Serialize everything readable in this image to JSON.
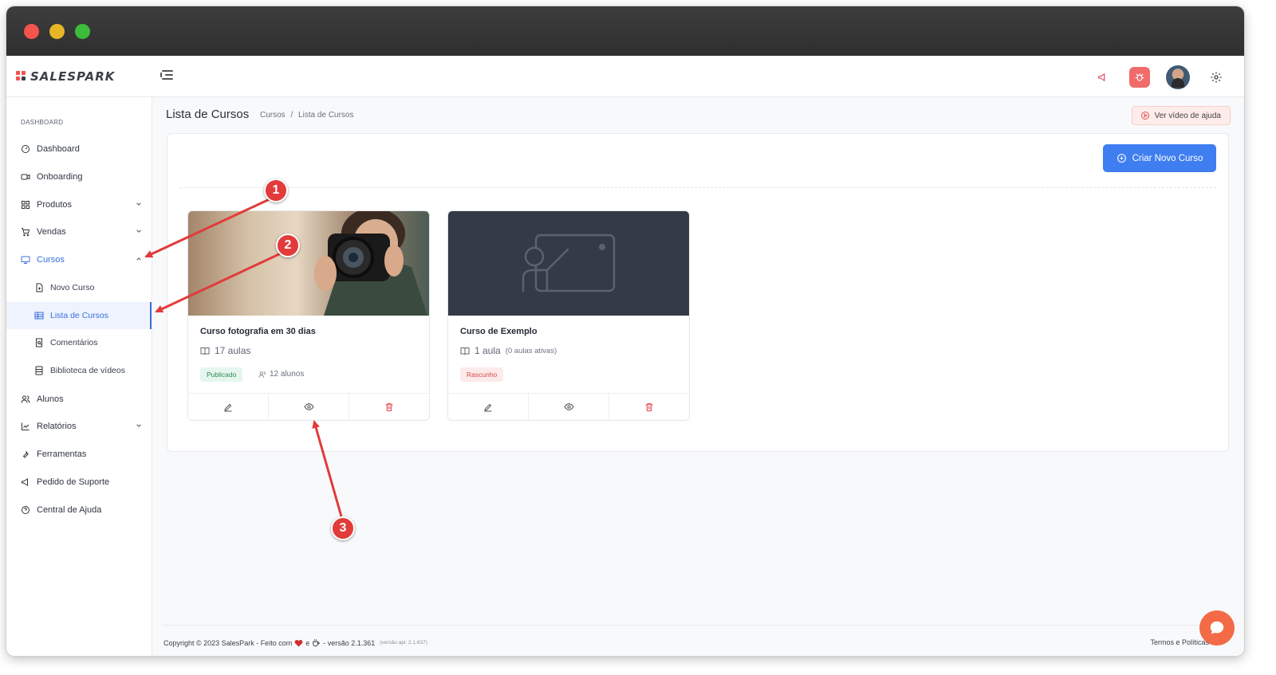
{
  "app": {
    "logo_text": "SALESPARK",
    "logo_prefix": "SALES",
    "logo_suffix": "PARK"
  },
  "sidebar": {
    "section_label": "DASHBOARD",
    "items": [
      {
        "label": "Dashboard"
      },
      {
        "label": "Onboarding"
      },
      {
        "label": "Produtos"
      },
      {
        "label": "Vendas"
      },
      {
        "label": "Cursos"
      },
      {
        "label": "Novo Curso"
      },
      {
        "label": "Lista de Cursos"
      },
      {
        "label": "Comentários"
      },
      {
        "label": "Biblioteca de vídeos"
      },
      {
        "label": "Alunos"
      },
      {
        "label": "Relatórios"
      },
      {
        "label": "Ferramentas"
      },
      {
        "label": "Pedido de Suporte"
      },
      {
        "label": "Central de Ajuda"
      }
    ]
  },
  "header": {
    "title": "Lista de Cursos",
    "breadcrumb": [
      "Cursos",
      "/",
      "Lista de Cursos"
    ],
    "help_button": "Ver vídeo de ajuda"
  },
  "toolbar": {
    "create_button": "Criar Novo Curso"
  },
  "courses": [
    {
      "title": "Curso fotografia em 30 dias",
      "lessons": "17 aulas",
      "lessons_note": "",
      "status": "Publicado",
      "students": "12 alunos"
    },
    {
      "title": "Curso de Exemplo",
      "lessons": "1 aula",
      "lessons_note": "(0 aulas ativas)",
      "status": "Rascunho",
      "students": ""
    }
  ],
  "footer": {
    "copyright": "Copyright © 2023 SalesPark - Feito com",
    "and": "e",
    "version": "- versão 2.1.361",
    "api_version": "(versão api: 2.1.637)",
    "terms": "Termos e Políticas"
  },
  "annotations": [
    "1",
    "2",
    "3"
  ],
  "colors": {
    "accent": "#3f7ef1",
    "brand": "#f2544d",
    "marker": "#e23b3b"
  }
}
